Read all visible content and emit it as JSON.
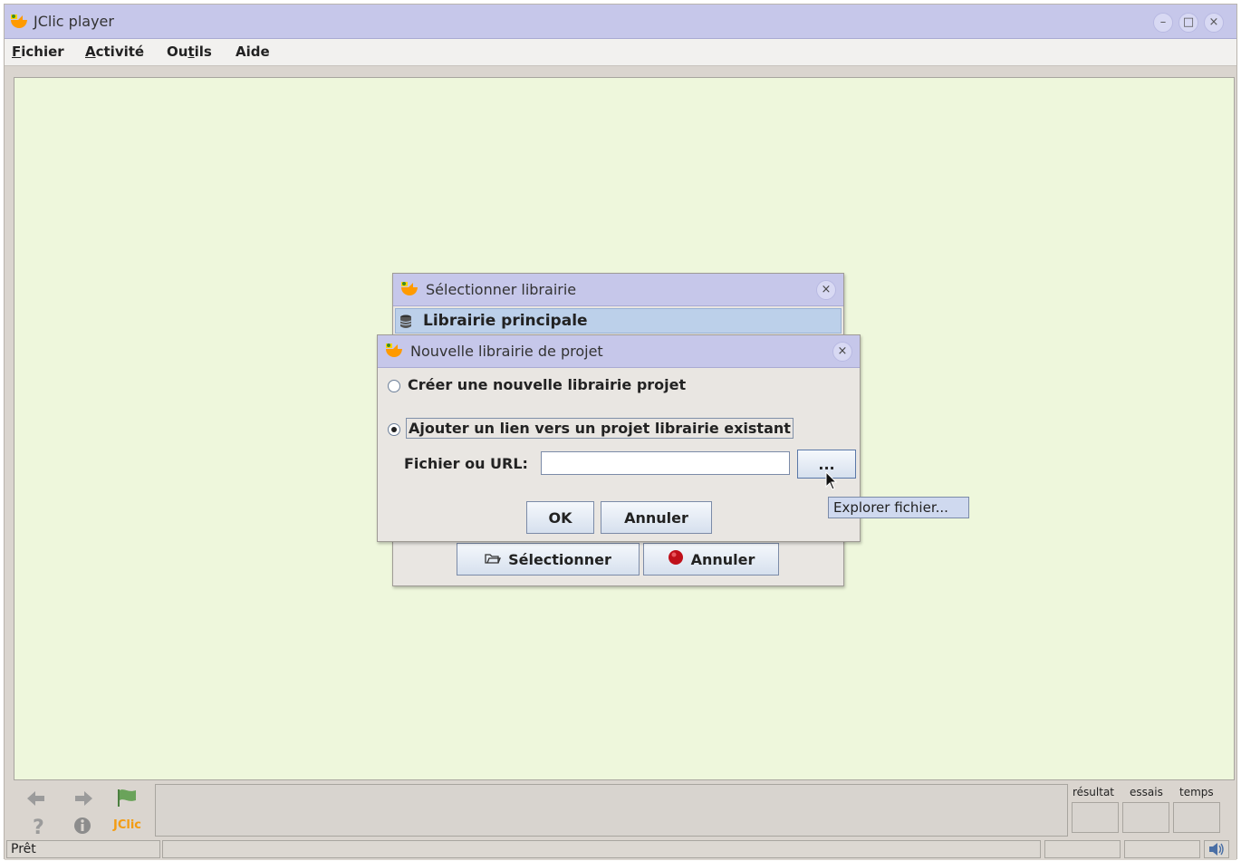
{
  "window": {
    "title": "JClic player"
  },
  "menu": [
    {
      "pre": "",
      "ul": "F",
      "post": "ichier"
    },
    {
      "pre": "",
      "ul": "A",
      "post": "ctivité"
    },
    {
      "pre": "Ou",
      "ul": "t",
      "post": "ils"
    },
    {
      "pre": "Aide",
      "ul": "",
      "post": ""
    }
  ],
  "select_dialog": {
    "title": "Sélectionner librairie",
    "library_item": "Librairie principale",
    "select_label": "Sélectionner",
    "cancel_label": "Annuler"
  },
  "new_library_dialog": {
    "title": "Nouvelle librairie de projet",
    "option_create": "Créer une nouvelle librairie projet",
    "option_link": "Ajouter un lien vers un projet librairie existant",
    "selected_option": "option_link",
    "file_label": "Fichier ou URL:",
    "file_value": "",
    "browse_label": "...",
    "ok_label": "OK",
    "cancel_label": "Annuler"
  },
  "tooltip": "Explorer fichier...",
  "counters": {
    "score": "résultat",
    "attempts": "essais",
    "time": "temps"
  },
  "navigation": {
    "logo_text": "JClic"
  },
  "status": {
    "text": "Prêt"
  },
  "icons": [
    "app-icon",
    "minimize-icon",
    "maximize-icon",
    "close-icon",
    "database-icon",
    "folder-icon",
    "stop-icon",
    "arrow-left-icon",
    "arrow-right-icon",
    "flag-icon",
    "help-icon",
    "info-icon",
    "speaker-icon",
    "mouse-pointer-icon"
  ],
  "colors": {
    "titlebar": "#c6c7ea",
    "content": "#eef7dc",
    "selection": "#bcd0ea",
    "logo": "#f39c12"
  }
}
